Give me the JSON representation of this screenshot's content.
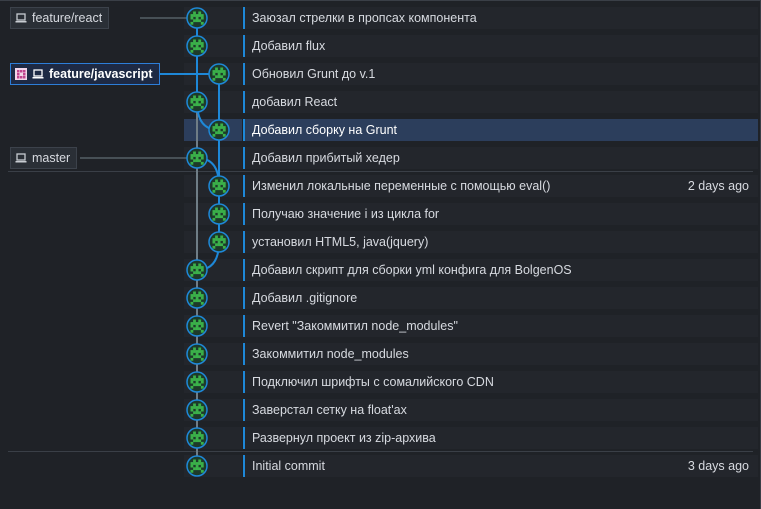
{
  "branches": [
    {
      "name": "feature/react",
      "row": 0,
      "active": false
    },
    {
      "name": "feature/javascript",
      "row": 2,
      "active": true
    },
    {
      "name": "master",
      "row": 5,
      "active": false
    }
  ],
  "commits": [
    {
      "message": "Заюзал стрелки в пропсах компонента",
      "lane": 0,
      "date": ""
    },
    {
      "message": "Добавил flux",
      "lane": 0,
      "date": ""
    },
    {
      "message": "Обновил Grunt до v.1",
      "lane": 1,
      "date": ""
    },
    {
      "message": "добавил React",
      "lane": 0,
      "date": ""
    },
    {
      "message": "Добавил сборку на Grunt",
      "lane": 1,
      "date": "",
      "selected": true
    },
    {
      "message": "Добавил прибитый хедер",
      "lane": 0,
      "date": ""
    },
    {
      "message": "Изменил локальные переменные с помощью eval()",
      "lane": 1,
      "date": "2 days ago"
    },
    {
      "message": "Получаю значение i из цикла for",
      "lane": 1,
      "date": ""
    },
    {
      "message": "установил HTML5, java(jquery)",
      "lane": 1,
      "date": ""
    },
    {
      "message": "Добавил скрипт для сборки yml конфига для BolgenOS",
      "lane": 0,
      "date": ""
    },
    {
      "message": "Добавил .gitignore",
      "lane": 0,
      "date": ""
    },
    {
      "message": "Revert \"Закоммитил node_modules\"",
      "lane": 0,
      "date": ""
    },
    {
      "message": "Закоммитил node_modules",
      "lane": 0,
      "date": ""
    },
    {
      "message": "Подключил шрифты с сомалийского CDN",
      "lane": 0,
      "date": ""
    },
    {
      "message": "Заверстал сетку на float'ax",
      "lane": 0,
      "date": ""
    },
    {
      "message": "Развернул проект из zip-архива",
      "lane": 0,
      "date": ""
    },
    {
      "message": "Initial commit",
      "lane": 0,
      "date": "3 days ago"
    }
  ],
  "group_separators_after_rows": [
    5,
    15
  ],
  "colors": {
    "background": "#1f2227",
    "row_background": "#23262c",
    "selected_row": "#2c3e5c",
    "graph_line_master": "#6f7d86",
    "graph_line_feature": "#1e88d8",
    "node_fill": "#3bb14a",
    "node_ring": "#1e88d8",
    "text": "#d7dae0"
  },
  "icons": {
    "branch": "laptop-icon",
    "active_branch_avatar": "identicon-avatar",
    "commit_avatar": "identicon-avatar"
  }
}
